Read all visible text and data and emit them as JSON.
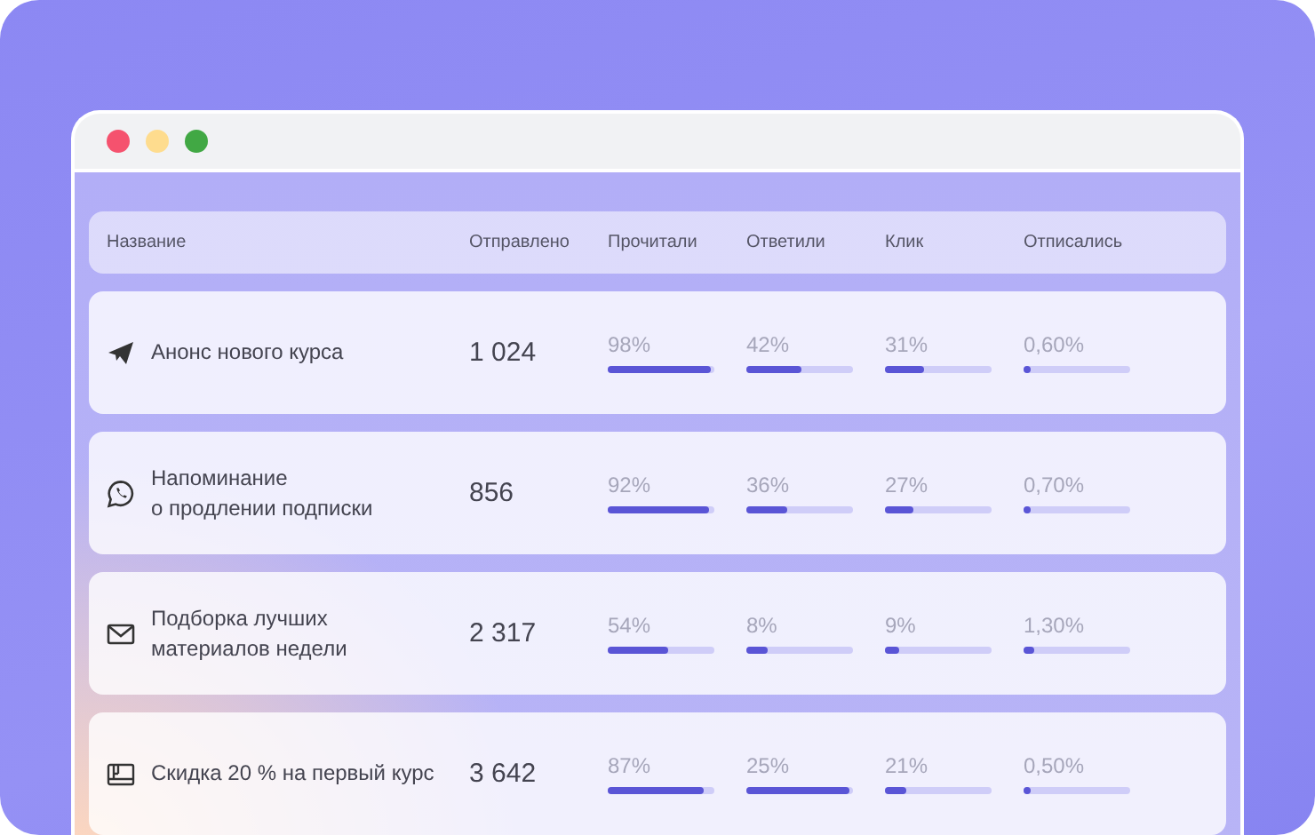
{
  "table": {
    "columns": [
      "Название",
      "Отправлено",
      "Прочитали",
      "Ответили",
      "Клик",
      "Отписались"
    ],
    "rows": [
      {
        "kind": "paper-plane",
        "name": "Анонс нового курса",
        "sent": "1 024",
        "metrics": [
          {
            "reading": "98%",
            "level": 0.96
          },
          {
            "reading": "42%",
            "level": 0.52
          },
          {
            "reading": "31%",
            "level": 0.37
          },
          {
            "reading": "0,60%",
            "level": 0.05
          }
        ]
      },
      {
        "kind": "chat-bubble",
        "name": "Напоминание\nо продлении подписки",
        "sent": "856",
        "metrics": [
          {
            "reading": "92%",
            "level": 0.95
          },
          {
            "reading": "36%",
            "level": 0.39
          },
          {
            "reading": "27%",
            "level": 0.27
          },
          {
            "reading": "0,70%",
            "level": 0.05
          }
        ]
      },
      {
        "kind": "envelope",
        "name": "Подборка лучших\nматериалов недели",
        "sent": "2 317",
        "metrics": [
          {
            "reading": "54%",
            "level": 0.56
          },
          {
            "reading": "8%",
            "level": 0.2
          },
          {
            "reading": "9%",
            "level": 0.13
          },
          {
            "reading": "1,30%",
            "level": 0.1
          }
        ]
      },
      {
        "kind": "card",
        "name": "Скидка 20 % на первый курс",
        "sent": "3 642",
        "metrics": [
          {
            "reading": "87%",
            "level": 0.9
          },
          {
            "reading": "25%",
            "level": 0.97
          },
          {
            "reading": "21%",
            "level": 0.2
          },
          {
            "reading": "0,50%",
            "level": 0.05
          }
        ]
      }
    ]
  }
}
